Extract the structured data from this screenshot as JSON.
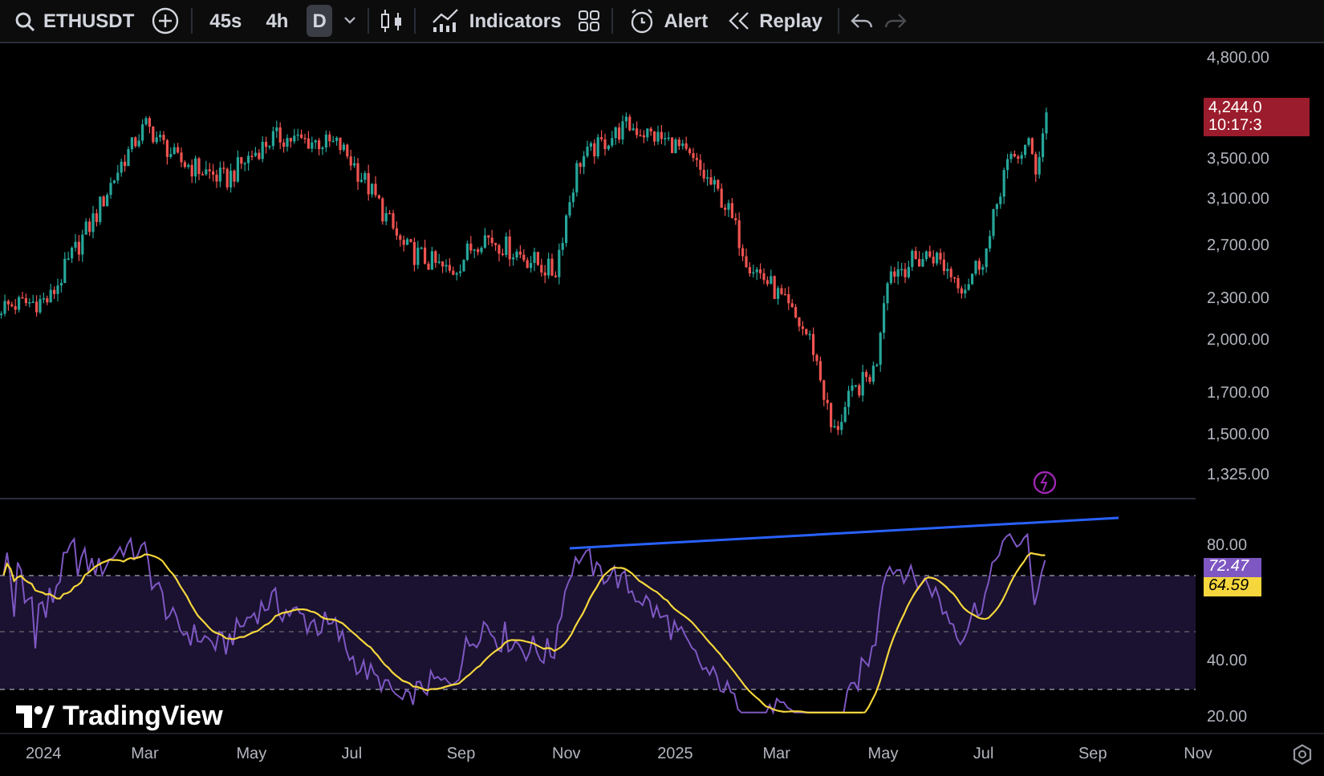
{
  "toolbar": {
    "symbol": "ETHUSDT",
    "intervals": [
      {
        "label": "45s",
        "selected": false
      },
      {
        "label": "4h",
        "selected": false
      },
      {
        "label": "D",
        "selected": true
      }
    ],
    "indicators_label": "Indicators",
    "alert_label": "Alert",
    "replay_label": "Replay",
    "redo_disabled": true
  },
  "price_axis": {
    "ticks": [
      "4,800.00",
      "3,500.00",
      "3,100.00",
      "2,700.00",
      "2,300.00",
      "2,000.00",
      "1,700.00",
      "1,500.00",
      "1,325.00"
    ],
    "last_price": {
      "value": "4,244.0",
      "countdown": "10:17:3"
    }
  },
  "rsi_axis": {
    "ticks": [
      "80.00",
      "40.00",
      "20.00"
    ],
    "values": [
      {
        "text": "72.47",
        "color": "#7e57c2"
      },
      {
        "text": "64.59",
        "color": "#f5d63d"
      }
    ]
  },
  "logo": {
    "text": "TradingView"
  },
  "time_axis": [
    "2024",
    "Mar",
    "May",
    "Jul",
    "Sep",
    "Nov",
    "2025",
    "Mar",
    "May",
    "Jul",
    "Sep",
    "Nov"
  ]
}
